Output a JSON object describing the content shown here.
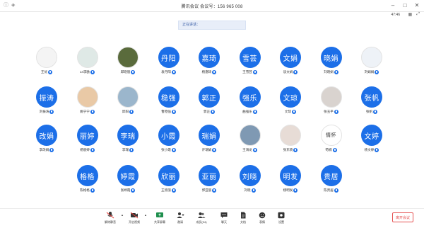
{
  "window": {
    "title": "腾讯会议  会议号：156 965 008",
    "clock": "47:46",
    "speaking_label": "正在讲话："
  },
  "colors": {
    "accent": "#1c6fe8",
    "leave": "#e55353"
  },
  "participants": [
    {
      "avatar": "",
      "name": "王优",
      "photo": true,
      "photo_color": "#f4f4f4"
    },
    {
      "avatar": "",
      "name": "14李欧",
      "photo": true,
      "photo_color": "#dfe9e6"
    },
    {
      "avatar": "",
      "name": "邱晓丽",
      "photo": true,
      "photo_color": "#5a6b3c"
    },
    {
      "avatar": "丹阳",
      "name": "袁丹阳",
      "photo": false
    },
    {
      "avatar": "嘉琦",
      "name": "杨嘉琦",
      "photo": false
    },
    {
      "avatar": "雪芸",
      "name": "王雪芸",
      "photo": false
    },
    {
      "avatar": "文娟",
      "name": "谈文娟",
      "photo": false
    },
    {
      "avatar": "晓娟",
      "name": "刘晓娟",
      "photo": false
    },
    {
      "avatar": "",
      "name": "刘娟娟",
      "photo": true,
      "photo_color": "#eef2f7"
    },
    {
      "avatar": "振涛",
      "name": "刘振涛",
      "photo": false
    },
    {
      "avatar": "",
      "name": "姚宁宁",
      "photo": true,
      "photo_color": "#e9c9a6"
    },
    {
      "avatar": "",
      "name": "邱阳",
      "photo": true,
      "photo_color": "#9bb6cc"
    },
    {
      "avatar": "稳强",
      "name": "曹稳强",
      "photo": false
    },
    {
      "avatar": "郭正",
      "name": "郭正",
      "photo": false
    },
    {
      "avatar": "强乐",
      "name": "曲强乐",
      "photo": false
    },
    {
      "avatar": "文琼",
      "name": "文琼",
      "photo": false
    },
    {
      "avatar": "",
      "name": "张玉平",
      "photo": true,
      "photo_color": "#d9d3cf"
    },
    {
      "avatar": "张帆",
      "name": "张帆",
      "photo": false
    },
    {
      "avatar": "改娟",
      "name": "李改娟",
      "photo": false
    },
    {
      "avatar": "丽婷",
      "name": "杨丽婷",
      "photo": false
    },
    {
      "avatar": "李瑞",
      "name": "李瑞",
      "photo": false
    },
    {
      "avatar": "小霞",
      "name": "张小霞",
      "photo": false
    },
    {
      "avatar": "瑞娟",
      "name": "许瑞娟",
      "photo": false
    },
    {
      "avatar": "",
      "name": "王海龙",
      "photo": true,
      "photo_color": "#7f99b3"
    },
    {
      "avatar": "",
      "name": "张东晓",
      "photo": true,
      "photo_color": "#e7dcd6"
    },
    {
      "avatar": "情怀",
      "name": "苟楠",
      "photo": true,
      "photo_color": "#ffffff"
    },
    {
      "avatar": "文婷",
      "name": "杨文婷",
      "photo": false
    },
    {
      "avatar": "格格",
      "name": "陈格格",
      "photo": false
    },
    {
      "avatar": "婷霞",
      "name": "张婷霞",
      "photo": false
    },
    {
      "avatar": "欣丽",
      "name": "王欣丽",
      "photo": false
    },
    {
      "avatar": "亚丽",
      "name": "郭亚丽",
      "photo": false
    },
    {
      "avatar": "刘晓",
      "name": "刘晓",
      "photo": false
    },
    {
      "avatar": "明发",
      "name": "杨明发",
      "photo": false
    },
    {
      "avatar": "贵居",
      "name": "陈贵居",
      "photo": false
    }
  ],
  "toolbar": {
    "mute": "解除静音",
    "video": "开启视频",
    "share": "共享屏幕",
    "invite": "邀请",
    "members": "成员(34)",
    "chat": "聊天",
    "docs": "文档",
    "reactions": "表情",
    "settings": "设置",
    "leave": "离开会议"
  }
}
